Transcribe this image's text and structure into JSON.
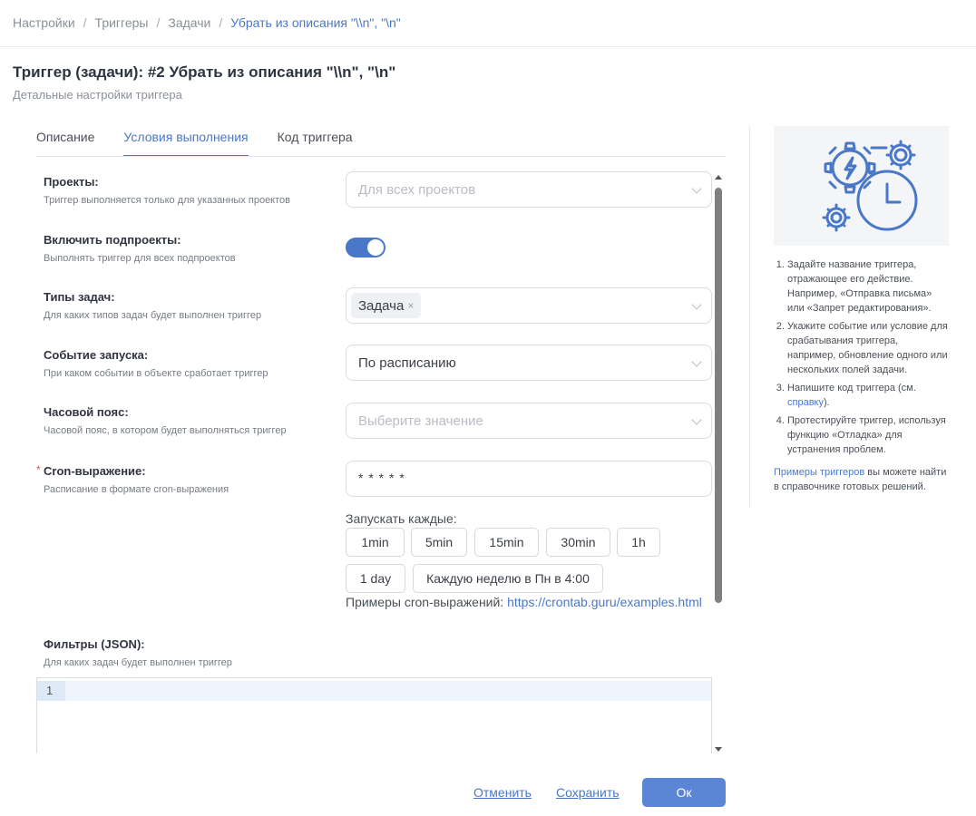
{
  "breadcrumb": {
    "items": [
      "Настройки",
      "Триггеры",
      "Задачи"
    ],
    "current": "Убрать из описания \"\\\\n\", \"\\n\""
  },
  "header": {
    "title": "Триггер (задачи): #2 Убрать из описания \"\\\\n\", \"\\n\"",
    "subtitle": "Детальные настройки триггера"
  },
  "tabs": [
    {
      "label": "Описание",
      "active": false
    },
    {
      "label": "Условия выполнения",
      "active": true
    },
    {
      "label": "Код триггера",
      "active": false
    }
  ],
  "form": {
    "projects": {
      "label": "Проекты:",
      "hint": "Триггер выполняется только для указанных проектов",
      "placeholder": "Для всех проектов"
    },
    "subprojects": {
      "label": "Включить подпроекты:",
      "hint": "Выполнять триггер для всех подпроектов",
      "enabled": true
    },
    "task_types": {
      "label": "Типы задач:",
      "hint": "Для каких типов задач будет выполнен триггер",
      "tag": "Задача",
      "tag_remove": "×"
    },
    "event": {
      "label": "Событие запуска:",
      "hint": "При каком событии в объекте сработает триггер",
      "value": "По расписанию"
    },
    "timezone": {
      "label": "Часовой пояс:",
      "hint": "Часовой пояс, в котором будет выполняться триггер",
      "placeholder": "Выберите значение"
    },
    "cron": {
      "required_mark": "*",
      "label": "Cron-выражение:",
      "hint": "Расписание в формате cron-выражения",
      "value": "* * * * *"
    },
    "run_every": {
      "label": "Запускать каждые:",
      "chips": [
        "1min",
        "5min",
        "15min",
        "30min",
        "1h",
        "1 day",
        "Каждую неделю в Пн в 4:00"
      ]
    },
    "examples": {
      "label": "Примеры cron-выражений:",
      "link": "https://crontab.guru/examples.html"
    },
    "filters": {
      "label": "Фильтры (JSON):",
      "hint": "Для каких задач будет выполнен триггер",
      "line_number": "1"
    }
  },
  "help": {
    "steps": [
      "Задайте название триггера, отражающее его действие. Например, «Отправка письма» или «Запрет редактирования».",
      "Укажите событие или условие для срабатывания триггера, например, обновление одного или нескольких полей задачи.",
      "Напишите код триггера (см. ",
      "Протестируйте триггер, используя функцию «Отладка» для устранения проблем."
    ],
    "step3_link": "справку",
    "step3_tail": ").",
    "footer_link": "Примеры триггеров",
    "footer_text": " вы можете найти в справочнике готовых решений."
  },
  "actions": {
    "cancel": "Отменить",
    "save": "Сохранить",
    "ok": "Ок"
  },
  "colors": {
    "accent": "#4a78c8",
    "ok_button": "#5b86d6"
  }
}
